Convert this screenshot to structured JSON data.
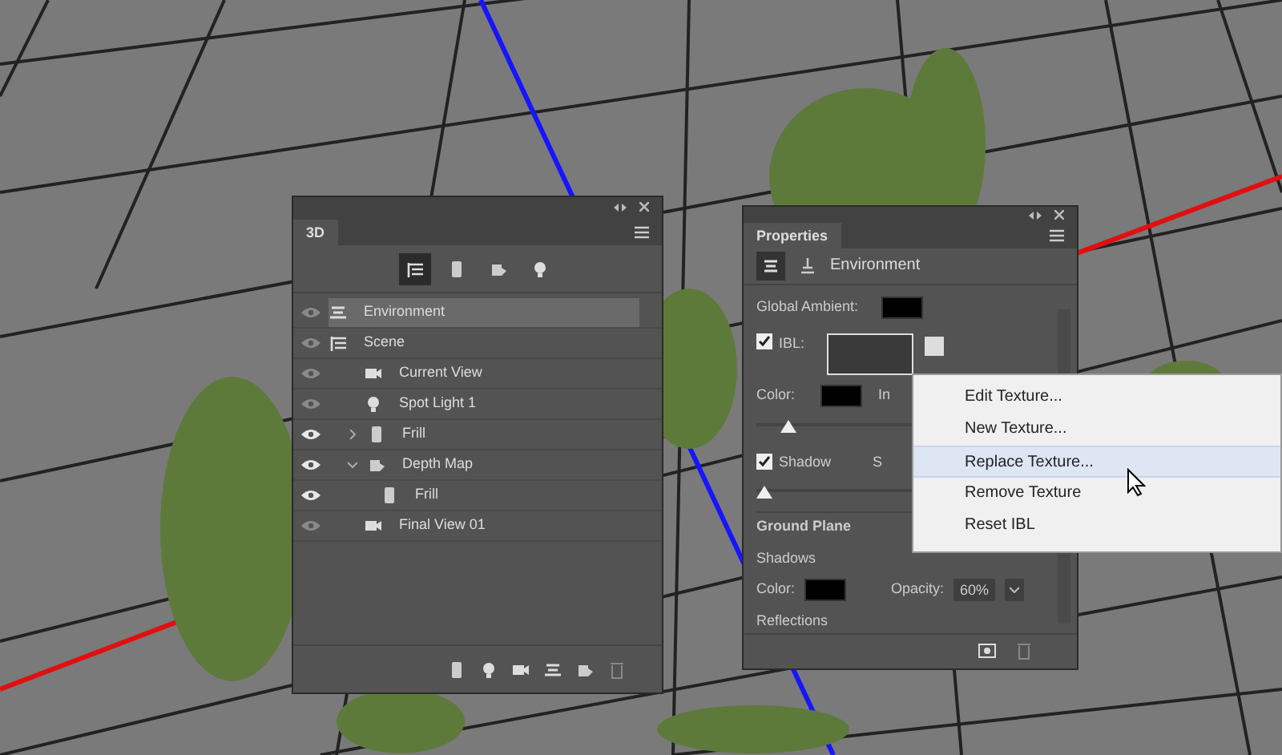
{
  "panel_3d": {
    "tab": "3D",
    "filter_buttons": [
      {
        "kind": "scene",
        "selected": true
      },
      {
        "kind": "mesh",
        "selected": false
      },
      {
        "kind": "material",
        "selected": false
      },
      {
        "kind": "light",
        "selected": false
      }
    ],
    "layers": [
      {
        "label": "Environment",
        "kind": "environment",
        "visible": false,
        "selected": true
      },
      {
        "label": "Scene",
        "kind": "scene",
        "visible": false,
        "selected": false,
        "children": [
          {
            "label": "Current View",
            "kind": "camera",
            "visible": false,
            "selected": false
          },
          {
            "label": "Spot Light 1",
            "kind": "light",
            "visible": false,
            "selected": false
          },
          {
            "label": "Frill",
            "kind": "mesh",
            "visible": true,
            "selected": false,
            "expanded": false
          },
          {
            "label": "Depth Map",
            "kind": "material",
            "visible": true,
            "selected": false,
            "expanded": true,
            "children": [
              {
                "label": "Frill",
                "kind": "mesh",
                "visible": true,
                "selected": false
              }
            ]
          },
          {
            "label": "Final View 01",
            "kind": "camera",
            "visible": false,
            "selected": false
          }
        ]
      }
    ]
  },
  "properties": {
    "tab": "Properties",
    "header": "Environment",
    "global_ambient_label": "Global Ambient:",
    "ibl_label": "IBL:",
    "ibl_checked": true,
    "color_label": "Color:",
    "intensity_label": "In",
    "intensity_slider": {
      "level": 0.09
    },
    "shadow_label": "Shadow",
    "shadow_checked": true,
    "softness_label": "S",
    "softness_slider": {
      "level": 0.0
    },
    "ground_plane": "Ground Plane",
    "shadows": "Shadows",
    "ground_color_label": "Color:",
    "opacity_label": "Opacity:",
    "opacity_value": "60%",
    "reflections": "Reflections"
  },
  "context_menu": [
    {
      "label": "Edit Texture...",
      "selected": false
    },
    {
      "label": "New Texture...",
      "selected": false
    },
    {
      "label": "Replace Texture...",
      "selected": true
    },
    {
      "label": "Remove Texture",
      "selected": false
    },
    {
      "label": "Reset IBL",
      "selected": false
    }
  ]
}
